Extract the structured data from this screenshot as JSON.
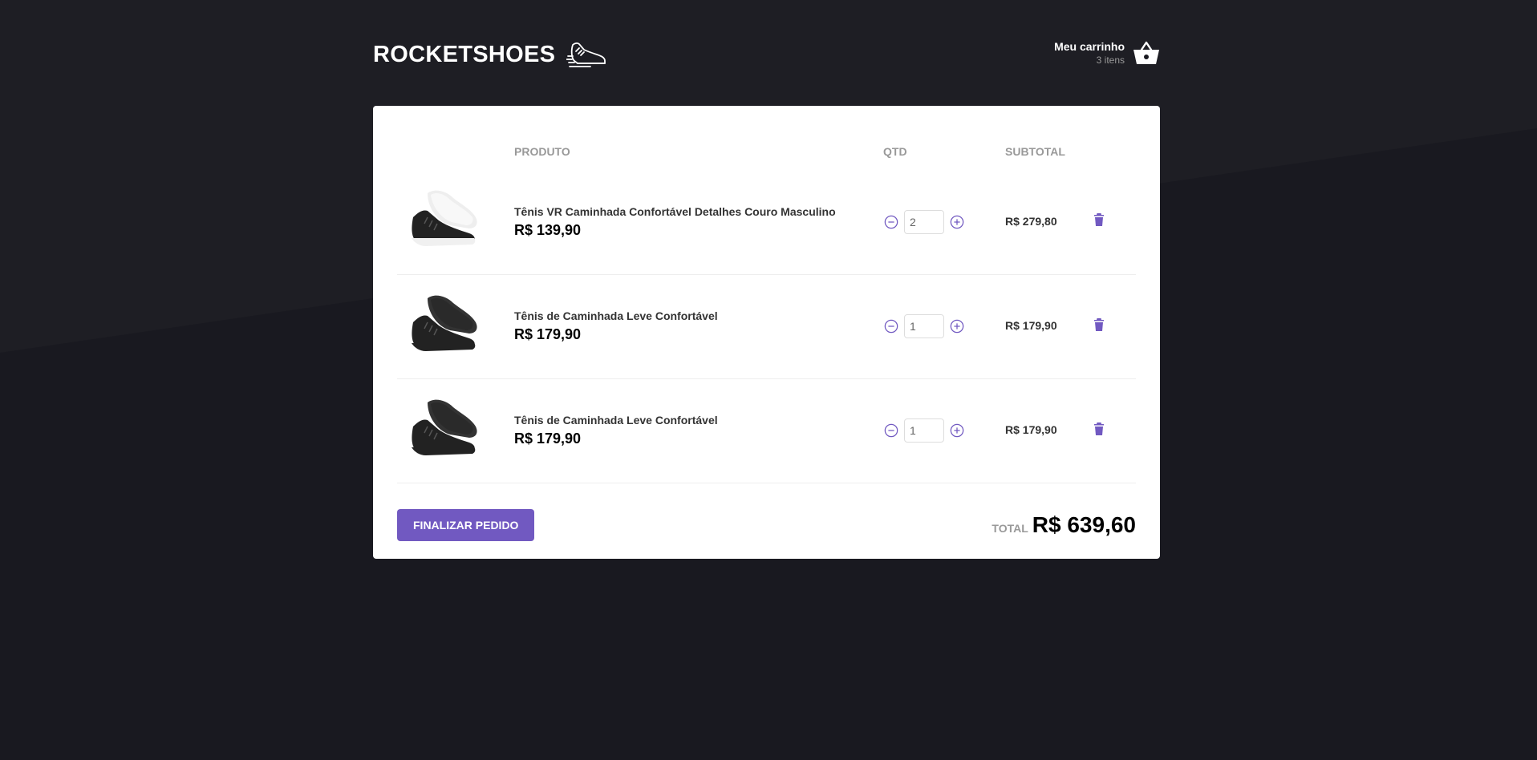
{
  "header": {
    "logo_text": "ROCKETSHOES",
    "cart_title": "Meu carrinho",
    "cart_count": "3 itens"
  },
  "table": {
    "headers": [
      "",
      "PRODUTO",
      "QTD",
      "SUBTOTAL",
      ""
    ],
    "rows": [
      {
        "name": "Tênis VR Caminhada Confortável Detalhes Couro Masculino",
        "price": "R$ 139,90",
        "qty": "2",
        "subtotal": "R$ 279,80",
        "sole": "light"
      },
      {
        "name": "Tênis de Caminhada Leve Confortável",
        "price": "R$ 179,90",
        "qty": "1",
        "subtotal": "R$ 179,90",
        "sole": "dark"
      },
      {
        "name": "Tênis de Caminhada Leve Confortável",
        "price": "R$ 179,90",
        "qty": "1",
        "subtotal": "R$ 179,90",
        "sole": "dark"
      }
    ]
  },
  "footer": {
    "checkout_label": "FINALIZAR PEDIDO",
    "total_label": "TOTAL",
    "total_value": "R$ 639,60"
  },
  "colors": {
    "background": "#191920",
    "accent": "#7159c1",
    "panel": "#ffffff"
  },
  "icons": {
    "logo": "running-shoe-icon",
    "cart": "shopping-basket-icon",
    "decrement": "minus-circle-icon",
    "increment": "plus-circle-icon",
    "delete": "trash-icon"
  }
}
